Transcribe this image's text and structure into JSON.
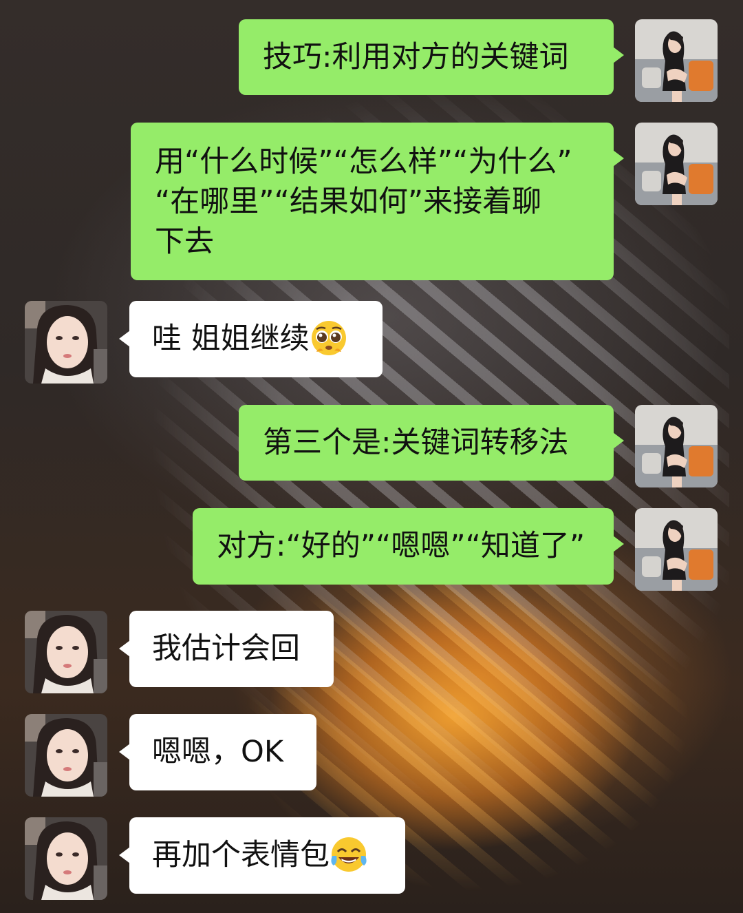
{
  "messages": [
    {
      "side": "right",
      "avatar": "avatar-self",
      "lines": [
        "技巧:利用对方的关键词"
      ]
    },
    {
      "side": "right",
      "avatar": "avatar-self",
      "lines": [
        "用“什么时候”“怎么样”“为什么”",
        "“在哪里”“结果如何”来接着聊",
        "下去"
      ]
    },
    {
      "side": "left",
      "avatar": "avatar-friend",
      "lines": [
        "哇 姐姐继续"
      ],
      "emoji": "pleading-face-emoji"
    },
    {
      "side": "right",
      "avatar": "avatar-self",
      "lines": [
        "第三个是:关键词转移法"
      ]
    },
    {
      "side": "right",
      "avatar": "avatar-self",
      "lines": [
        "对方:“好的”“嗯嗯”“知道了”"
      ]
    },
    {
      "side": "left",
      "avatar": "avatar-friend",
      "lines": [
        "我估计会回"
      ]
    },
    {
      "side": "left",
      "avatar": "avatar-friend",
      "lines": [
        "嗯嗯，OK"
      ]
    },
    {
      "side": "left",
      "avatar": "avatar-friend",
      "lines": [
        "再加个表情包"
      ],
      "emoji": "tears-of-joy-emoji"
    }
  ],
  "colors": {
    "sent_bubble": "#95ec69",
    "received_bubble": "#ffffff"
  }
}
